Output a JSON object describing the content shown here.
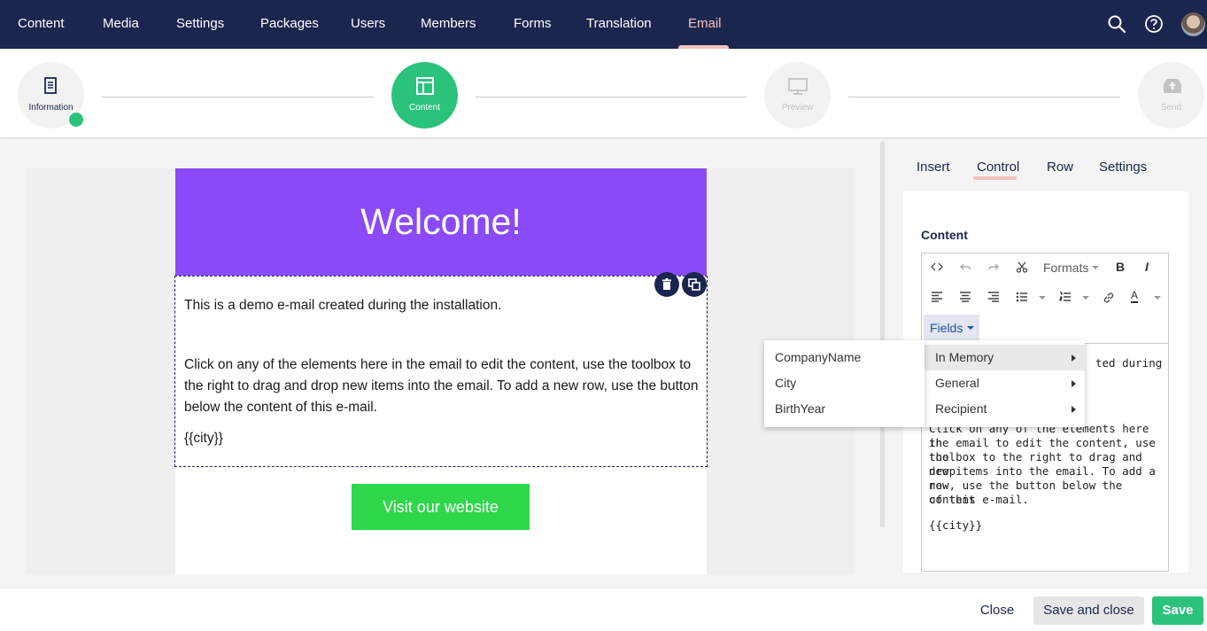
{
  "nav": {
    "items": [
      "Content",
      "Media",
      "Settings",
      "Packages",
      "Users",
      "Members",
      "Forms",
      "Translation",
      "Email"
    ],
    "active": "Email"
  },
  "steps": [
    {
      "label": "Information",
      "icon": "document-icon",
      "state": "done"
    },
    {
      "label": "Content",
      "icon": "layout-icon",
      "state": "active"
    },
    {
      "label": "Preview",
      "icon": "monitor-icon",
      "state": "disabled"
    },
    {
      "label": "Send",
      "icon": "send-icon",
      "state": "disabled"
    }
  ],
  "email": {
    "header": "Welcome!",
    "para1": "This is a demo e-mail created during the installation.",
    "para2": "Click on any of the elements here in the email to edit the content, use the toolbox to the right to drag and drop new items into the email. To add a new row, use the button below the content of this e-mail.",
    "para3": "{{city}}",
    "cta": "Visit our website"
  },
  "panel": {
    "tabs": [
      "Insert",
      "Control",
      "Row",
      "Settings"
    ],
    "active_tab": "Control",
    "content_label": "Content",
    "toolbar": {
      "formats": "Formats",
      "fields": "Fields"
    },
    "editor_lines": {
      "l1": "ted during",
      "l2": "Click on any of the elements here in",
      "l3": "the email to edit the content, use the",
      "l4": "toolbox to the right to drag and drop",
      "l5": "new items into the email. To add a new",
      "l6": "row, use the button below the content",
      "l7": "of this e-mail.",
      "l8": "{{city}}"
    }
  },
  "fields_menu": {
    "groups": [
      "In Memory",
      "General",
      "Recipient"
    ],
    "submenu": [
      "CompanyName",
      "City",
      "BirthYear"
    ]
  },
  "footer": {
    "close": "Close",
    "save_close": "Save and close",
    "save": "Save"
  },
  "colors": {
    "nav": "#1b264f",
    "accent": "#2bc37c",
    "header_bg": "#8b4af8",
    "cta": "#2ed84a"
  }
}
